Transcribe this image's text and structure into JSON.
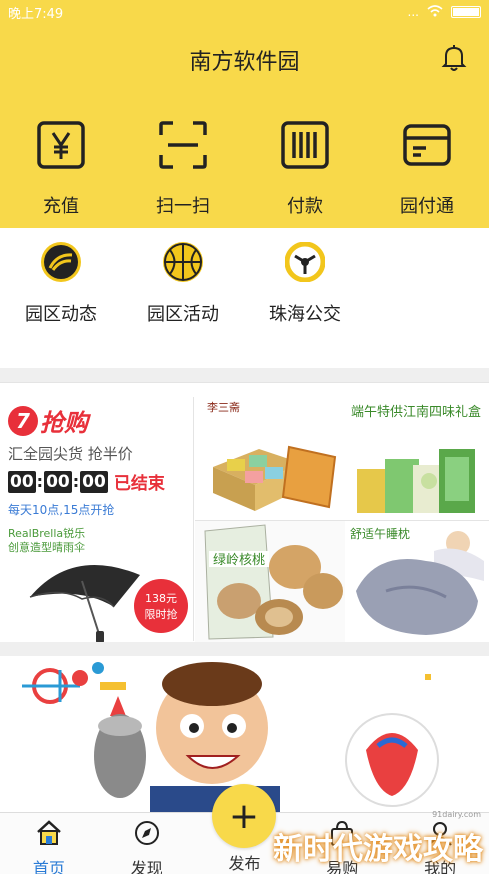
{
  "status_bar": {
    "time": "晚上7:49",
    "network": "...",
    "battery_icon": "battery-icon"
  },
  "header": {
    "title": "南方软件园",
    "notification_icon": "bell-icon"
  },
  "quick_actions": [
    {
      "label": "充值",
      "icon": "yen-icon"
    },
    {
      "label": "扫一扫",
      "icon": "scan-icon"
    },
    {
      "label": "付款",
      "icon": "barcode-icon"
    },
    {
      "label": "园付通",
      "icon": "card-icon"
    }
  ],
  "shortcuts": [
    {
      "label": "园区动态",
      "icon": "news-icon"
    },
    {
      "label": "园区活动",
      "icon": "basketball-icon"
    },
    {
      "label": "珠海公交",
      "icon": "bus-icon"
    }
  ],
  "promo": {
    "flash_sale": {
      "logo_char": "7",
      "logo_text": "抢购",
      "slogan": "汇全园尖货 抢半价",
      "timer": [
        "00",
        "00",
        "00"
      ],
      "status": "已结束",
      "times": "每天10点,15点开抢",
      "brand_line1": "RealBrella锐乐",
      "brand_line2": "创意造型晴雨伞",
      "price": "138元",
      "price_tag": "限时抢"
    },
    "dragon_boat": {
      "seal": "李三斋",
      "headline": "端午特供江南四味礼盒"
    },
    "walnut": {
      "package_text": "绿岭核桃"
    },
    "pillow": {
      "caption": "舒适午睡枕"
    }
  },
  "bottom_nav": [
    {
      "label": "首页",
      "icon": "home-icon",
      "active": true
    },
    {
      "label": "发现",
      "icon": "compass-icon",
      "active": false
    },
    {
      "label": "发布",
      "icon": "plus-icon",
      "active": false
    },
    {
      "label": "易购",
      "icon": "shopping-bag-icon",
      "active": false
    },
    {
      "label": "我的",
      "icon": "user-icon",
      "active": false
    }
  ],
  "watermark": {
    "text": "新时代游戏攻略",
    "url": "91dairy.com"
  },
  "colors": {
    "brand_yellow": "#f8d94a",
    "accent_red": "#e8303a",
    "active_blue": "#2a7bd5"
  }
}
